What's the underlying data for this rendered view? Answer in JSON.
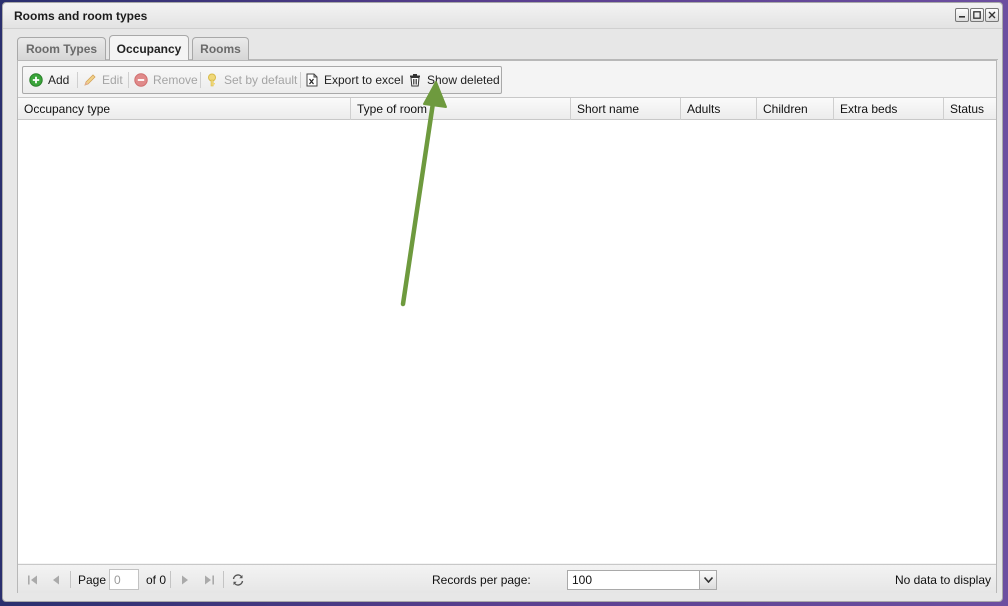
{
  "window": {
    "title": "Rooms and room types"
  },
  "tabs": [
    {
      "label": "Room Types",
      "active": false
    },
    {
      "label": "Occupancy",
      "active": true
    },
    {
      "label": "Rooms",
      "active": false
    }
  ],
  "toolbar": {
    "add": "Add",
    "edit": "Edit",
    "remove": "Remove",
    "set_default": "Set by default",
    "export": "Export to excel",
    "show_deleted": "Show deleted"
  },
  "grid": {
    "columns": [
      "Occupancy type",
      "Type of room",
      "Short name",
      "Adults",
      "Children",
      "Extra beds",
      "Status"
    ]
  },
  "pager": {
    "page_label": "Page",
    "page_value": "0",
    "of_label": "of 0",
    "records_label": "Records per page:",
    "records_value": "100",
    "status": "No data to display"
  },
  "colors": {
    "annotation_arrow": "#6e9a3e",
    "add_icon": "#3aa53a",
    "remove_icon": "#e08a8a"
  },
  "icons": {
    "add": "add-icon",
    "edit": "pencil-icon",
    "remove": "remove-icon",
    "set_default": "key-icon",
    "export": "excel-icon",
    "show_deleted": "trash-icon"
  }
}
